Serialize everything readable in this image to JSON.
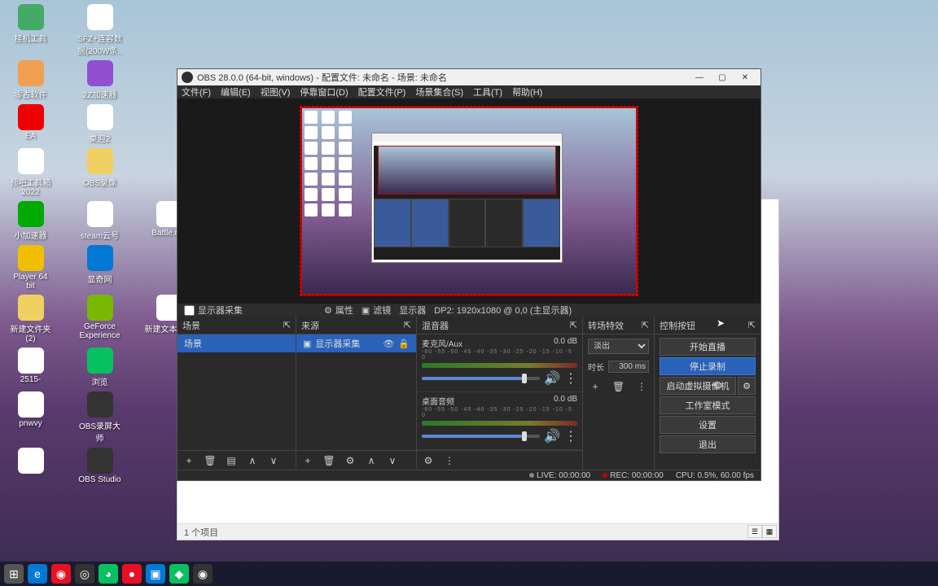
{
  "desktop_icons": [
    [
      {
        "label": "挂机工具",
        "color": "#4a6"
      },
      {
        "label": "SFZ+连容数\n据(200W条..",
        "color": "#fff"
      }
    ],
    [
      {
        "label": "零占软件",
        "color": "#f0a050"
      },
      {
        "label": "2Z加速器",
        "color": "#9050d0"
      }
    ],
    [
      {
        "label": "EA",
        "color": "#e00"
      },
      {
        "label": "桌迎2",
        "color": "#fff"
      }
    ],
    [
      {
        "label": "预吧工具箱\n2022",
        "color": "#fff"
      },
      {
        "label": "OBS录像",
        "color": "#f0d060"
      }
    ],
    [
      {
        "label": "小加速器",
        "color": "#0a0"
      },
      {
        "label": "steam云号",
        "color": "#fff"
      },
      {
        "label": "Battle.net",
        "color": "#fff"
      }
    ],
    [
      {
        "label": "Player 64\nbit",
        "color": "#f0c000"
      },
      {
        "label": "显奇网",
        "color": "#0078d4"
      }
    ],
    [
      {
        "label": "新建文件夹\n(2)",
        "color": "#f0d060"
      },
      {
        "label": "GeForce\nExperience",
        "color": "#76b900"
      },
      {
        "label": "新建文本文档",
        "color": "#fff"
      }
    ],
    [
      {
        "label": "2515-",
        "color": "#fff"
      },
      {
        "label": "浏览",
        "color": "#07c160"
      }
    ],
    [
      {
        "label": "pnwvy",
        "color": "#fff"
      },
      {
        "label": "OBS录屏大\n师",
        "color": "#333"
      }
    ],
    [
      {
        "label": "",
        "color": ""
      },
      {
        "label": "OBS Studio",
        "color": "#333"
      }
    ]
  ],
  "obs": {
    "title": "OBS 28.0.0 (64-bit, windows) - 配置文件: 未命名 - 场景: 未命名",
    "menus": [
      "文件(F)",
      "编辑(E)",
      "视图(V)",
      "停靠窗口(D)",
      "配置文件(P)",
      "场景集合(S)",
      "工具(T)",
      "帮助(H)"
    ],
    "source_toolbar": {
      "checkbox": "显示器采集",
      "props": "属性",
      "filter": "滤镜",
      "display": "显示器",
      "info": "DP2: 1920x1080 @ 0,0 (主显示器)"
    },
    "panels": {
      "scenes": {
        "title": "场景",
        "items": [
          "场景"
        ]
      },
      "sources": {
        "title": "来源",
        "items": [
          {
            "label": "显示器采集",
            "visible": true,
            "locked": true
          }
        ]
      },
      "mixer": {
        "title": "混音器",
        "channels": [
          {
            "name": "麦克风/Aux",
            "db": "0.0 dB"
          },
          {
            "name": "桌面音频",
            "db": "0.0 dB"
          }
        ]
      },
      "transitions": {
        "title": "转场特效",
        "selected": "淡出",
        "duration_label": "时长",
        "duration": "300 ms"
      },
      "controls": {
        "title": "控制按钮",
        "buttons": {
          "stream": "开始直播",
          "stop_rec": "停止录制",
          "vcam": "启动虚拟摄像机",
          "studio": "工作室模式",
          "settings": "设置",
          "exit": "退出"
        }
      }
    },
    "status": {
      "live": "LIVE: 00:00:00",
      "rec": "REC: 00:00:00",
      "cpu": "CPU: 0.5%, 60.00 fps"
    }
  },
  "explorer": {
    "status": "1 个项目"
  }
}
